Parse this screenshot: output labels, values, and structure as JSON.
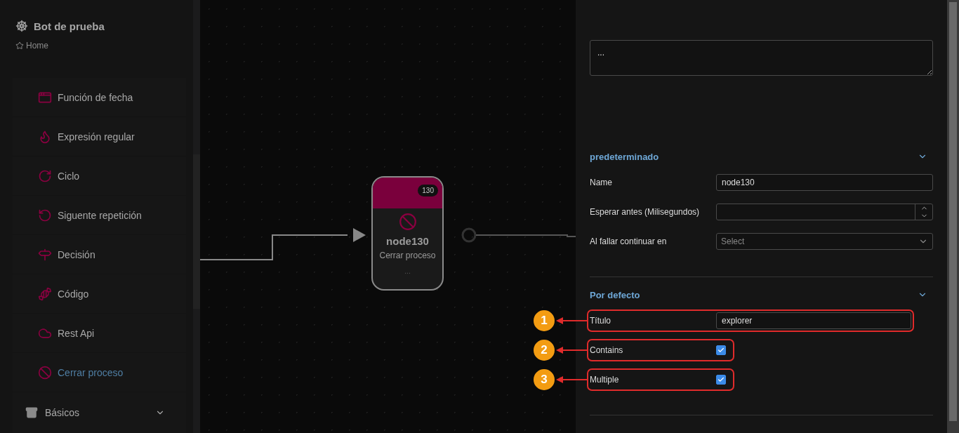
{
  "sidebar": {
    "title": "Bot de prueba",
    "breadcrumb": "Home",
    "items": [
      {
        "label": "Función de fecha",
        "selected": false
      },
      {
        "label": "Expresión regular",
        "selected": false
      },
      {
        "label": "Ciclo",
        "selected": false
      },
      {
        "label": "Siguente repetición",
        "selected": false
      },
      {
        "label": "Decisión",
        "selected": false
      },
      {
        "label": "Código",
        "selected": false
      },
      {
        "label": "Rest Api",
        "selected": false
      },
      {
        "label": "Cerrar proceso",
        "selected": true
      }
    ],
    "group": {
      "label": "Básicos",
      "expanded": false
    }
  },
  "canvas": {
    "node": {
      "badge": "130",
      "name": "node130",
      "subtitle": "Cerrar proceso",
      "footer": "..."
    }
  },
  "panel": {
    "description": "...",
    "sections": [
      {
        "title": "predeterminado",
        "expanded": true,
        "fields": [
          {
            "kind": "text",
            "label": "Name",
            "value": "node130",
            "highlighted": false
          },
          {
            "kind": "number",
            "label": "Esperar antes (Milisegundos)",
            "highlighted": false
          },
          {
            "kind": "select",
            "label": "Al fallar continuar en",
            "placeholder": "Select",
            "highlighted": false
          }
        ]
      },
      {
        "title": "Por defecto",
        "expanded": true,
        "fields": [
          {
            "kind": "text",
            "label": "Título",
            "value": "explorer",
            "highlighted": true,
            "marker": "1"
          },
          {
            "kind": "checkbox",
            "label": "Contains",
            "checked": true,
            "highlighted": true,
            "marker": "2"
          },
          {
            "kind": "checkbox",
            "label": "Multiple",
            "checked": true,
            "highlighted": true,
            "marker": "3"
          }
        ]
      }
    ]
  }
}
